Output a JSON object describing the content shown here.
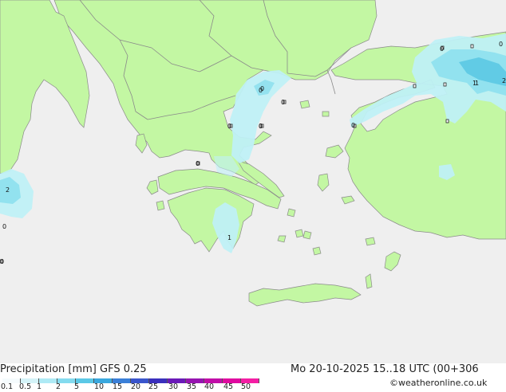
{
  "map": {
    "labels": [
      {
        "text": "0",
        "id": "label-0-black-sea"
      },
      {
        "text": "0",
        "id": "label-0-black-sea-north"
      },
      {
        "text": "1",
        "id": "label-1-black-sea-east"
      },
      {
        "text": "0",
        "id": "label-0-bosphorus"
      },
      {
        "text": "0",
        "id": "label-0-marmara-east"
      },
      {
        "text": "1",
        "id": "label-1-anatolia-coast"
      },
      {
        "text": "2",
        "id": "label-2-anatolia-edge"
      },
      {
        "text": "0",
        "id": "label-0-anatolia-inland"
      },
      {
        "text": "0",
        "id": "label-0-dardanelles"
      },
      {
        "text": "0",
        "id": "label-0-macedonia"
      },
      {
        "text": "0",
        "id": "label-0-chalkidiki-west"
      },
      {
        "text": "0",
        "id": "label-0-chalkidiki-east"
      },
      {
        "text": "0",
        "id": "label-0-epirus"
      },
      {
        "text": "1",
        "id": "label-1-peloponnese"
      },
      {
        "text": "2",
        "id": "label-2-italy"
      },
      {
        "text": "0",
        "id": "label-0-ionian"
      },
      {
        "text": "0",
        "id": "label-0-sicily-channel"
      }
    ],
    "colors": {
      "sea": "#efefef",
      "land": "#c3f7a3",
      "border": "#8a8a8a",
      "precip_light": "#bff0f6",
      "precip_med": "#8fe0ee",
      "precip_heavy": "#5fc9e4"
    }
  },
  "footer": {
    "title": "Precipitation [mm]  GFS 0.25",
    "datetime": "Mo 20-10-2025 15..18 UTC (00+306",
    "credit": "©weatheronline.co.uk"
  },
  "legend": {
    "ticks": [
      "0.1",
      "0.5",
      "1",
      "2",
      "5",
      "10",
      "15",
      "20",
      "25",
      "30",
      "35",
      "40",
      "45",
      "50"
    ],
    "colors": [
      "#f5fbfd",
      "#d4f3f8",
      "#aeeaf5",
      "#84dbef",
      "#5bc8e6",
      "#3aa8de",
      "#3a7fd8",
      "#3a55cc",
      "#3a2fbd",
      "#6a1ab8",
      "#9614b0",
      "#c10ea8",
      "#e00aa0",
      "#f41ea4"
    ]
  }
}
